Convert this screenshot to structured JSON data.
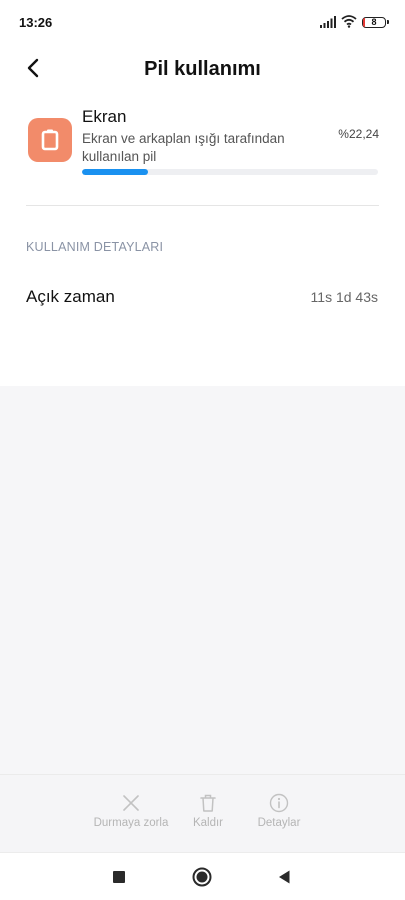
{
  "status_bar": {
    "time": "13:26",
    "battery_level": "8",
    "icons": [
      "signal-icon",
      "wifi-icon",
      "battery-icon"
    ]
  },
  "header": {
    "title": "Pil kullanımı",
    "back_icon": "chevron-left-icon"
  },
  "app": {
    "name": "Ekran",
    "description": "Ekran ve arkaplan ışığı tarafından kullanılan pil",
    "percent": "%22,24",
    "usage_fraction": 0.2224,
    "icon": "screen-icon",
    "icon_color": "#f28b6a",
    "bar_color": "#1a91f0"
  },
  "details": {
    "section_title": "KULLANIM DETAYLARI",
    "rows": [
      {
        "label": "Açık zaman",
        "value": "11s 1d 43s"
      }
    ]
  },
  "actions": [
    {
      "label": "Durmaya zorla",
      "icon": "close-icon"
    },
    {
      "label": "Kaldır",
      "icon": "trash-icon"
    },
    {
      "label": "Detaylar",
      "icon": "info-icon"
    }
  ],
  "nav": [
    "recents-icon",
    "home-icon",
    "back-icon"
  ]
}
